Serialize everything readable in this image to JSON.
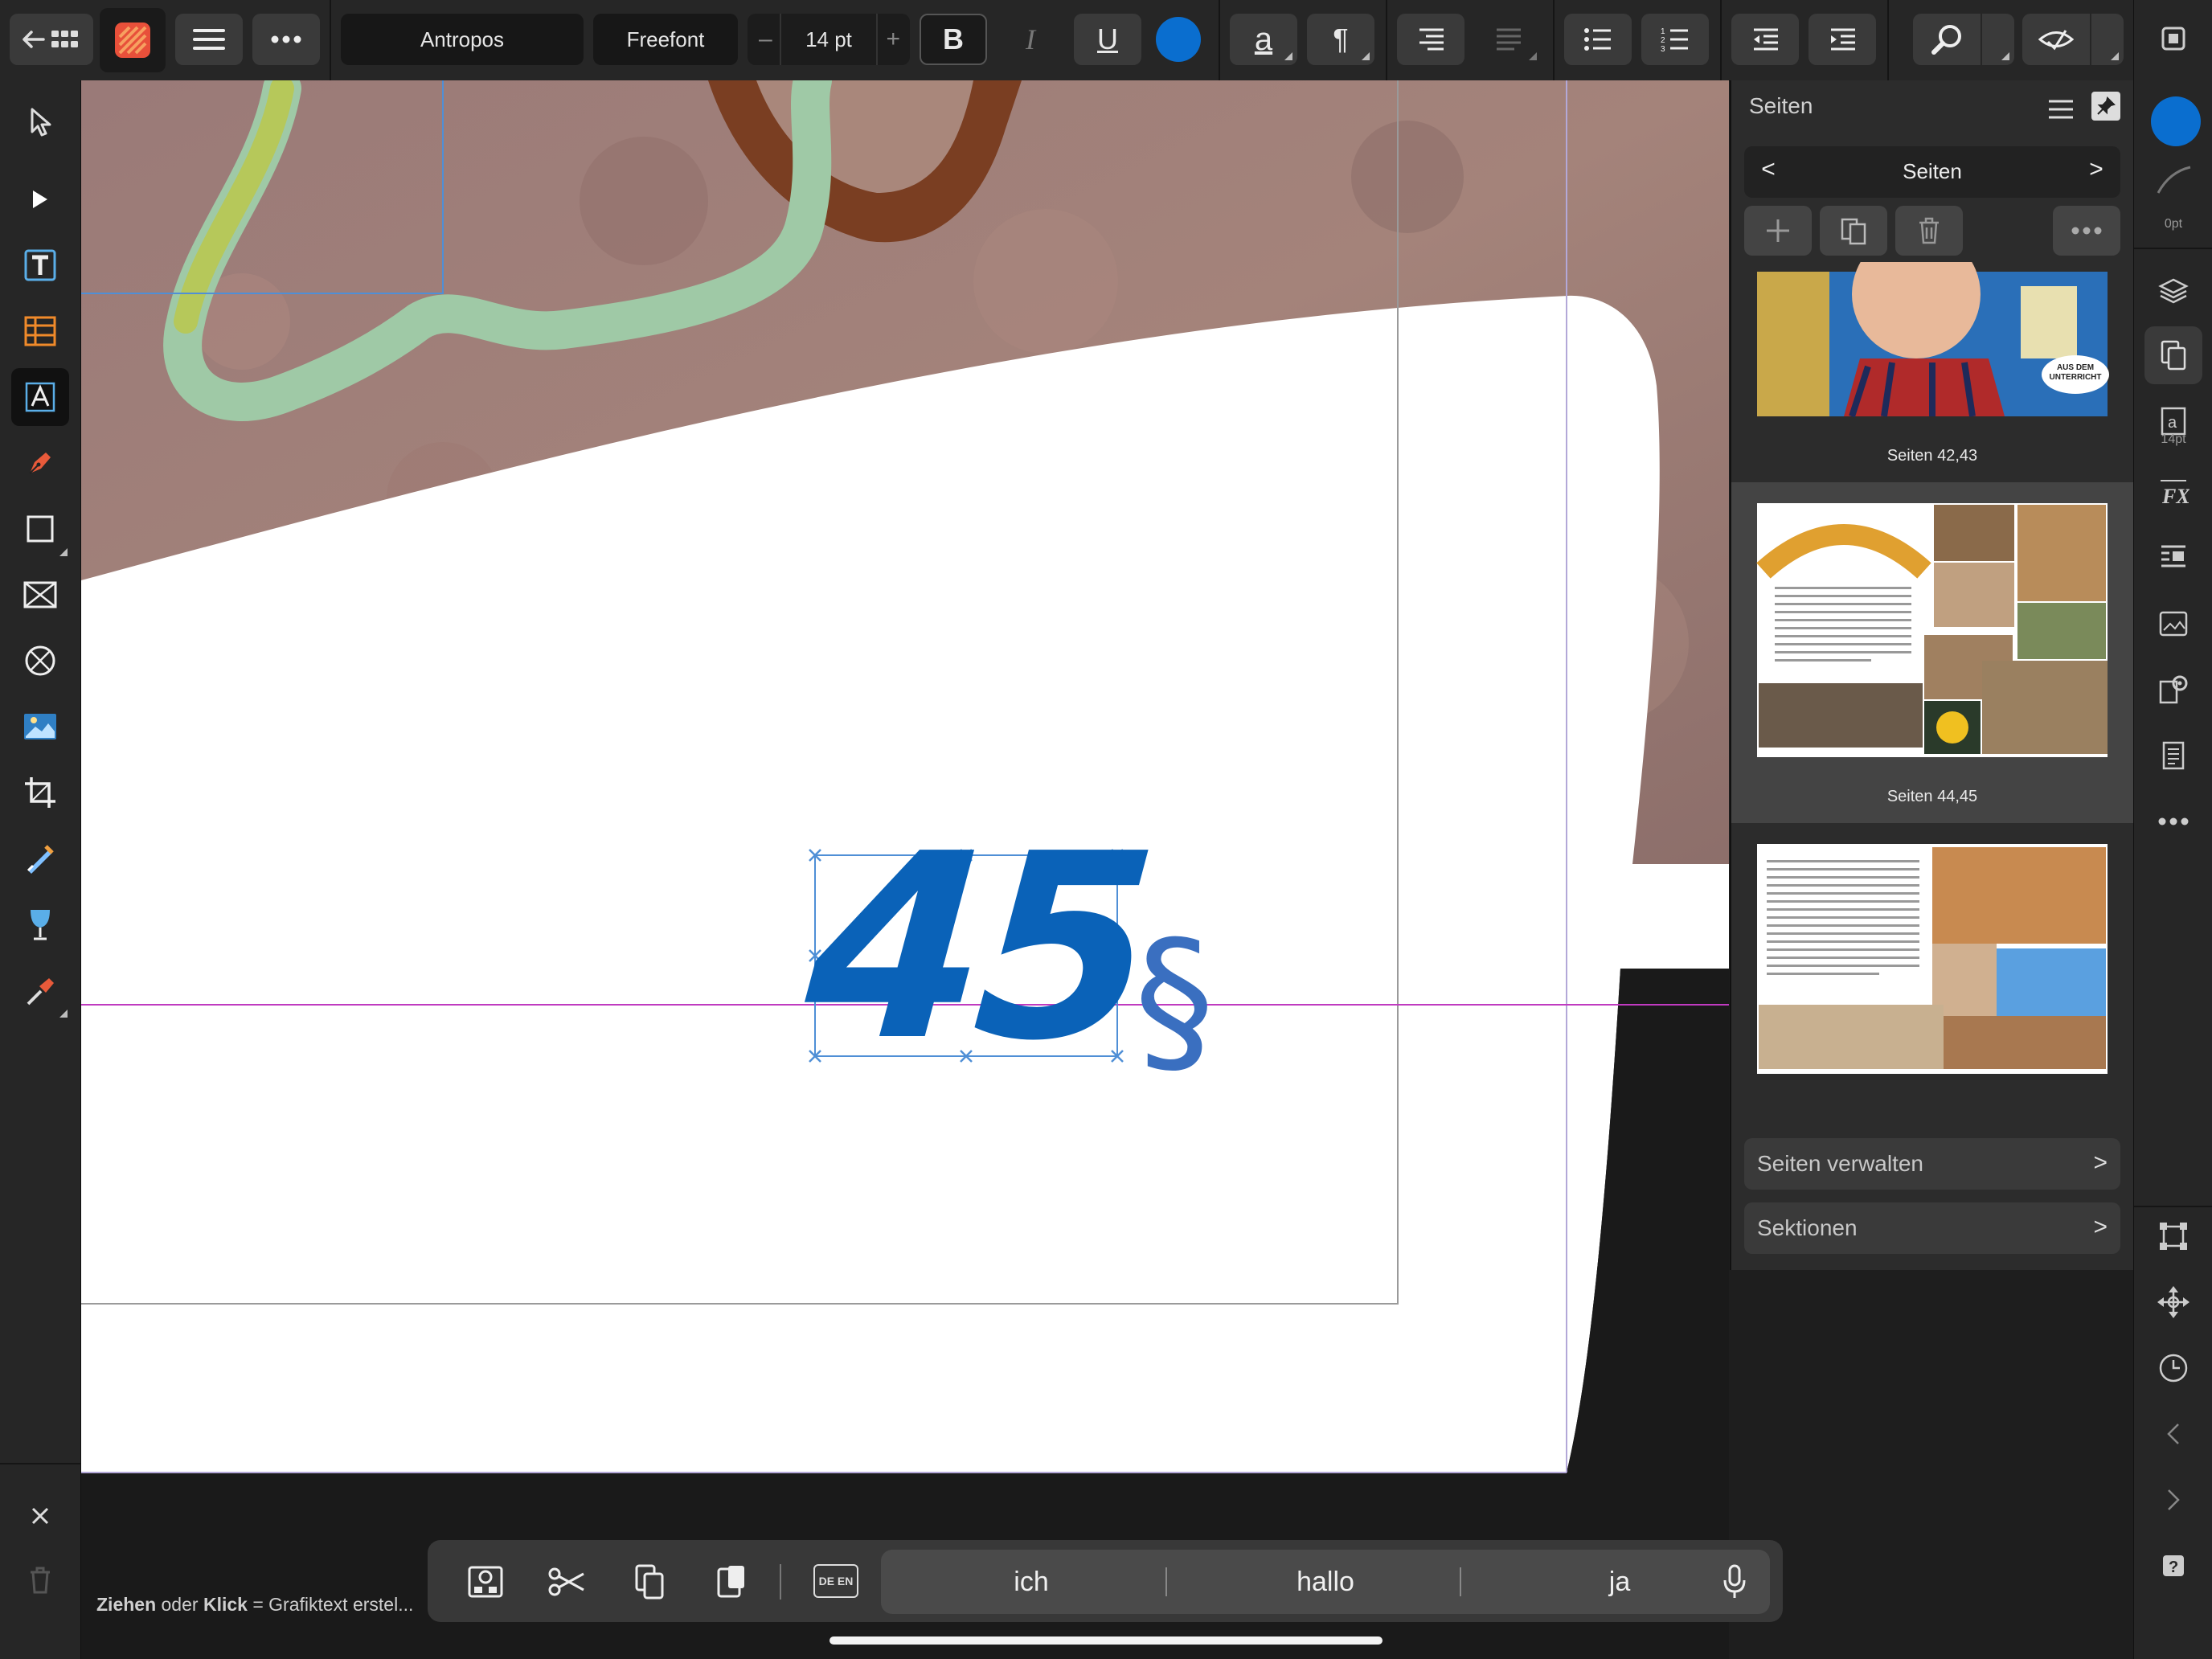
{
  "toolbar": {
    "font_name": "Antropos",
    "font_style": "Freefont",
    "font_size": "14 pt",
    "minus": "–",
    "plus": "+",
    "bold": "B",
    "italic": "I",
    "underline": "U",
    "text_color": "#0a6ecf",
    "char_a": "a",
    "pilcrow": "¶"
  },
  "canvas": {
    "page_number": "45",
    "section_symbol": "§",
    "number_color": "#0a62b8",
    "symbol_color": "#3a6fc0"
  },
  "panel": {
    "title": "Seiten",
    "nav_title": "Seiten",
    "thumb_badge": "AUS DEM UNTERRICHT",
    "thumbs": [
      {
        "caption": "Seiten 42,43"
      },
      {
        "caption": "Seiten 44,45"
      },
      {
        "caption": ""
      }
    ],
    "manage_pages": "Seiten verwalten",
    "sections": "Sektionen"
  },
  "rightbar": {
    "stroke_width": "0pt",
    "text_size": "14pt",
    "fill_color": "#0a6ecf"
  },
  "keyboard": {
    "lang": "DE EN",
    "suggestions": [
      "ich",
      "hallo",
      "ja"
    ]
  },
  "status": {
    "w1": "Ziehen",
    "w2": " oder ",
    "w3": "Klick",
    "w4": " = Grafiktext erstel..."
  }
}
